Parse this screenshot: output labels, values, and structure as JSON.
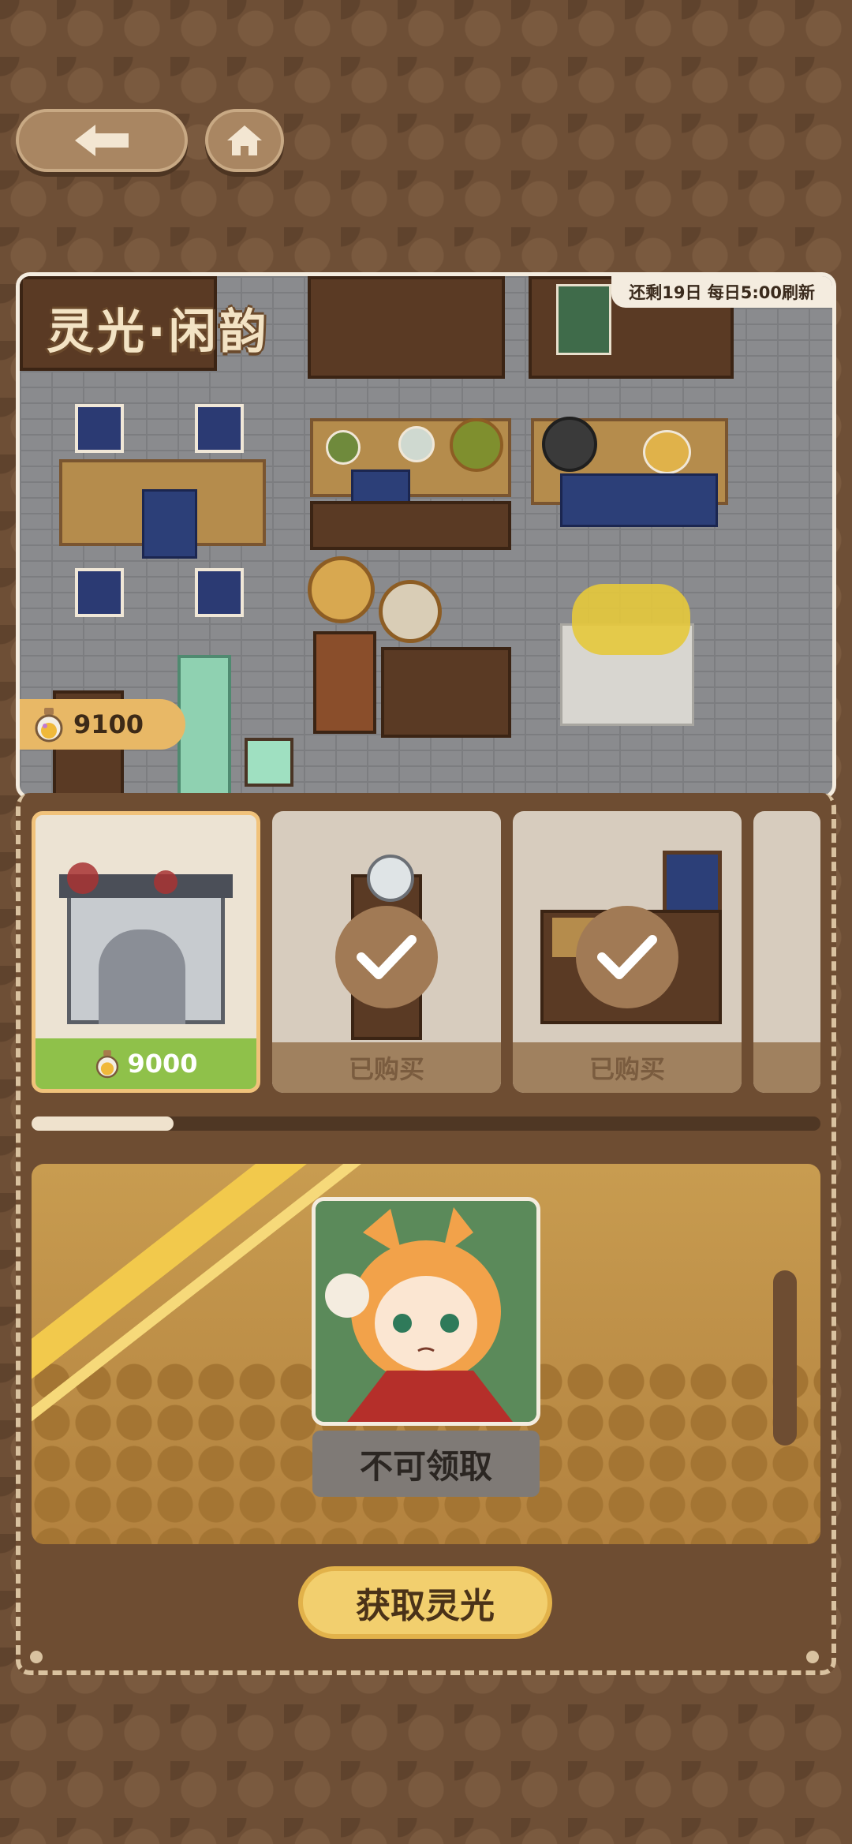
{
  "nav": {
    "back_icon": "arrow-left-icon",
    "home_icon": "home-icon"
  },
  "scene": {
    "title": "灵光·闲韵",
    "refresh_note": "还剩19日 每日5:00刷新",
    "currency_icon": "potion-bottle-icon",
    "currency_amount": "9100"
  },
  "shop": {
    "items": [
      {
        "name": "snow-plum-garden-gate",
        "price": "9000",
        "status": "price",
        "icon": "potion-bottle-icon"
      },
      {
        "name": "tea-kettle-chair",
        "status_label": "已购买",
        "status": "owned"
      },
      {
        "name": "tea-table-with-bench",
        "status_label": "已购买",
        "status": "owned"
      }
    ],
    "scroll_progress": 0.18
  },
  "reward": {
    "portrait": "fox-eared-girl-avatar",
    "claim_label": "不可领取"
  },
  "footer": {
    "get_label": "获取灵光"
  },
  "colors": {
    "accent_gold": "#f2cf6e",
    "price_green": "#8fc14a",
    "panel_brown": "#6e4d32"
  }
}
